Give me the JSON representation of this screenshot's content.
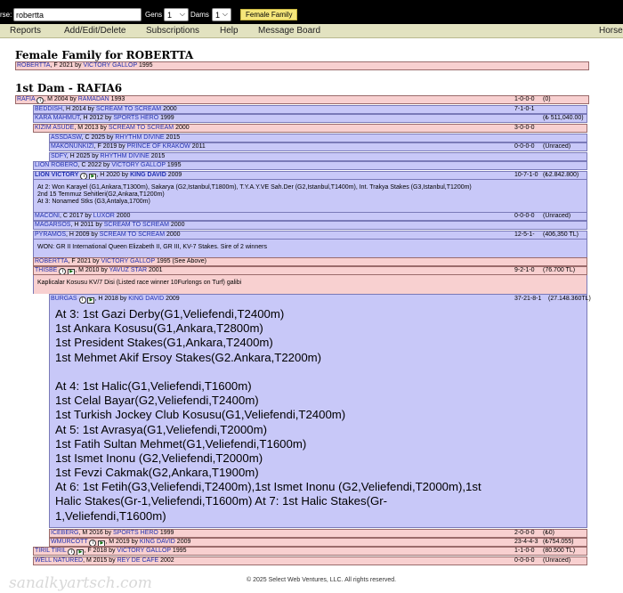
{
  "search": {
    "label": "rse:",
    "value": "robertta",
    "gens_label": "Gens",
    "gens_value": "1",
    "dams_label": "Dams",
    "dams_value": "1",
    "button": "Female Family"
  },
  "menu": {
    "items": [
      "Reports",
      "Add/Edit/Delete",
      "Subscriptions",
      "Help",
      "Message Board"
    ],
    "right": "Horse:"
  },
  "title": "Female Family for ROBERTTA",
  "root": {
    "name": "ROBERTTA",
    "info": ", F 2021 by ",
    "sire": "VICTORY GALLOP",
    "year": " 1995"
  },
  "dam_heading": "1st Dam - RAFIA6",
  "rows": [
    {
      "name": "RAFIA",
      "icons": "i",
      "info": ", M 2004 by ",
      "sire": "RAMADAN",
      "year": " 1993",
      "rec": "1-0-0-0",
      "earn": "(0)"
    },
    {
      "name": "BEDDISH",
      "info": ", H 2014 by ",
      "sire": "SCREAM TO SCREAM",
      "year": " 2000",
      "rec": "7-1-0-1",
      "earn": ""
    },
    {
      "name": "KARA MAHMUT",
      "info": ", H 2012 by ",
      "sire": "SPORTS HERO",
      "year": " 1999",
      "rec": "",
      "earn": "(₺ 511,040.00)"
    },
    {
      "name": "KIZIM ASUDE",
      "info": ", M 2013 by ",
      "sire": "SCREAM TO SCREAM",
      "year": " 2000",
      "rec": "3-0-0-0",
      "earn": ""
    },
    {
      "name": "ASSDASW",
      "info": ", C 2025 by ",
      "sire": "RHYTHM DIVINE",
      "year": " 2015",
      "rec": "",
      "earn": ""
    },
    {
      "name": "MAKONUNKIZI",
      "info": ", F 2019 by ",
      "sire": "PRINCE OF KRAKOW",
      "year": " 2011",
      "rec": "0-0-0-0",
      "earn": "(Unraced)"
    },
    {
      "name": "SDFY",
      "info": ", H 2025 by ",
      "sire": "RHYTHM DIVINE",
      "year": " 2015",
      "rec": "",
      "earn": ""
    },
    {
      "name": "LION ROBERO",
      "info": ", C 2022 by ",
      "sire": "VICTORY GALLOP",
      "year": " 1995",
      "rec": "",
      "earn": ""
    },
    {
      "name": "LION VICTORY",
      "icons": "i2",
      "info": ", H 2020 by ",
      "sire": "KING DAVID",
      "year": " 2009",
      "rec": "10-7-1-0",
      "earn": "(₺2.842.800)"
    },
    {
      "name": "MACONI",
      "info": ", C 2017 by ",
      "sire": "LUXOR",
      "year": " 2000",
      "rec": "0-0-0-0",
      "earn": "(Unraced)"
    },
    {
      "name": "MAGARSOS",
      "info": ", H 2011 by ",
      "sire": "SCREAM TO SCREAM",
      "year": " 2000",
      "rec": "",
      "earn": ""
    },
    {
      "name": "PYRAMOS",
      "info": ", H 2009 by ",
      "sire": "SCREAM TO SCREAM",
      "year": " 2000",
      "rec": "12-5-1-",
      "earn": "(406,350 TL)"
    },
    {
      "name": "ROBERTTA",
      "info": ", F 2021 by ",
      "sire": "VICTORY GALLOP",
      "year": " 1995 (See Above)",
      "rec": "",
      "earn": ""
    },
    {
      "name": "THISBE",
      "icons": "i2",
      "info": ", M 2010 by ",
      "sire": "YAVUZ STAR",
      "year": " 2001",
      "rec": "9-2-1-0",
      "earn": "(76.700 TL)"
    }
  ],
  "notes": {
    "lion_victory": [
      "At 2: Won Karayel (G1,Ankara,T1300m), Sakarya (G2,Istanbul,T1800m), T.Y.A.Y.VE Sah.Der (G2,Istanbul,T1400m), Int. Trakya Stakes (G3,Istanbul,T1200m)",
      "2nd 15 Temmuz Sehitleri(G2,Ankara,T1200m)",
      "At 3: Nonamed Stks (G3,Antalya,1700m)"
    ],
    "pyramos": "WON: GR II International Queen Elizabeth II, GR III, KV-7 Stakes. Sire of 2 winners",
    "thisbe": "Kaplicalar Kosusu KV/7 Disi (Listed race winner 10Furlongs on Turf) galibi"
  },
  "burgas": {
    "name": "BURGAS",
    "info": ", H 2018 by ",
    "sire": "KING DAVID",
    "year": " 2009",
    "rec": "37-21-8-1",
    "earn": "(27.148.360TL)",
    "lines": [
      "At 3: 1st Gazi Derby(G1,Veliefendi,T2400m)",
      "1st Ankara Kosusu(G1,Ankara,T2800m)",
      "1st President Stakes(G1,Ankara,T2400m)",
      "1st Mehmet Akif Ersoy Stakes(G2.Ankara,T2200m)",
      "",
      "At 4: 1st Halic(G1,Veliefendi,T1600m)",
      "1st Celal Bayar(G2,Veliefendi,T2400m)",
      "1st Turkish Jockey Club Kosusu(G1,Veliefendi,T2400m)",
      "At 5: 1st Avrasya(G1,Veliefendi,T2000m)",
      "1st Fatih Sultan Mehmet(G1,Veliefendi,T1600m)",
      "1st Ismet Inonu (G2,Veliefendi,T2000m)",
      "1st Fevzi Cakmak(G2,Ankara,T1900m)",
      "At 6: 1st Fetih(G3,Veliefendi,T2400m),1st Ismet Inonu (G2,Veliefendi,T2000m),1st",
      "Halic Stakes(Gr-1,Veliefendi,T1600m) At 7: 1st Halic Stakes(Gr-",
      "1,Veliefendi,T1600m)"
    ]
  },
  "tail_rows": [
    {
      "name": "ICEBERG",
      "info": ", M 2016 by ",
      "sire": "SPORTS HERO",
      "year": " 1999",
      "rec": "2-0-0-0",
      "earn": "(₺0)"
    },
    {
      "name": "WMURCOTT",
      "icons": "i2",
      "info": ", M 2019 by ",
      "sire": "KING DAVID",
      "year": " 2009",
      "rec": "23-4-4-3",
      "earn": "(₺754.055)"
    },
    {
      "name": "TIRIL TIRIL",
      "icons": "i2",
      "info": ", F 2018 by ",
      "sire": "VICTORY GALLOP",
      "year": " 1995",
      "rec": "1-1-0-0",
      "earn": "(80.500 TL)"
    },
    {
      "name": "WELL NATURED",
      "info": ", M 2015 by ",
      "sire": "REY DE CAFE",
      "year": " 2002",
      "rec": "0-0-0-0",
      "earn": "(Unraced)"
    }
  ],
  "footer": "© 2025 Select Web Ventures, LLC. All rights reserved.",
  "watermark": "sanalkyartsch.com"
}
